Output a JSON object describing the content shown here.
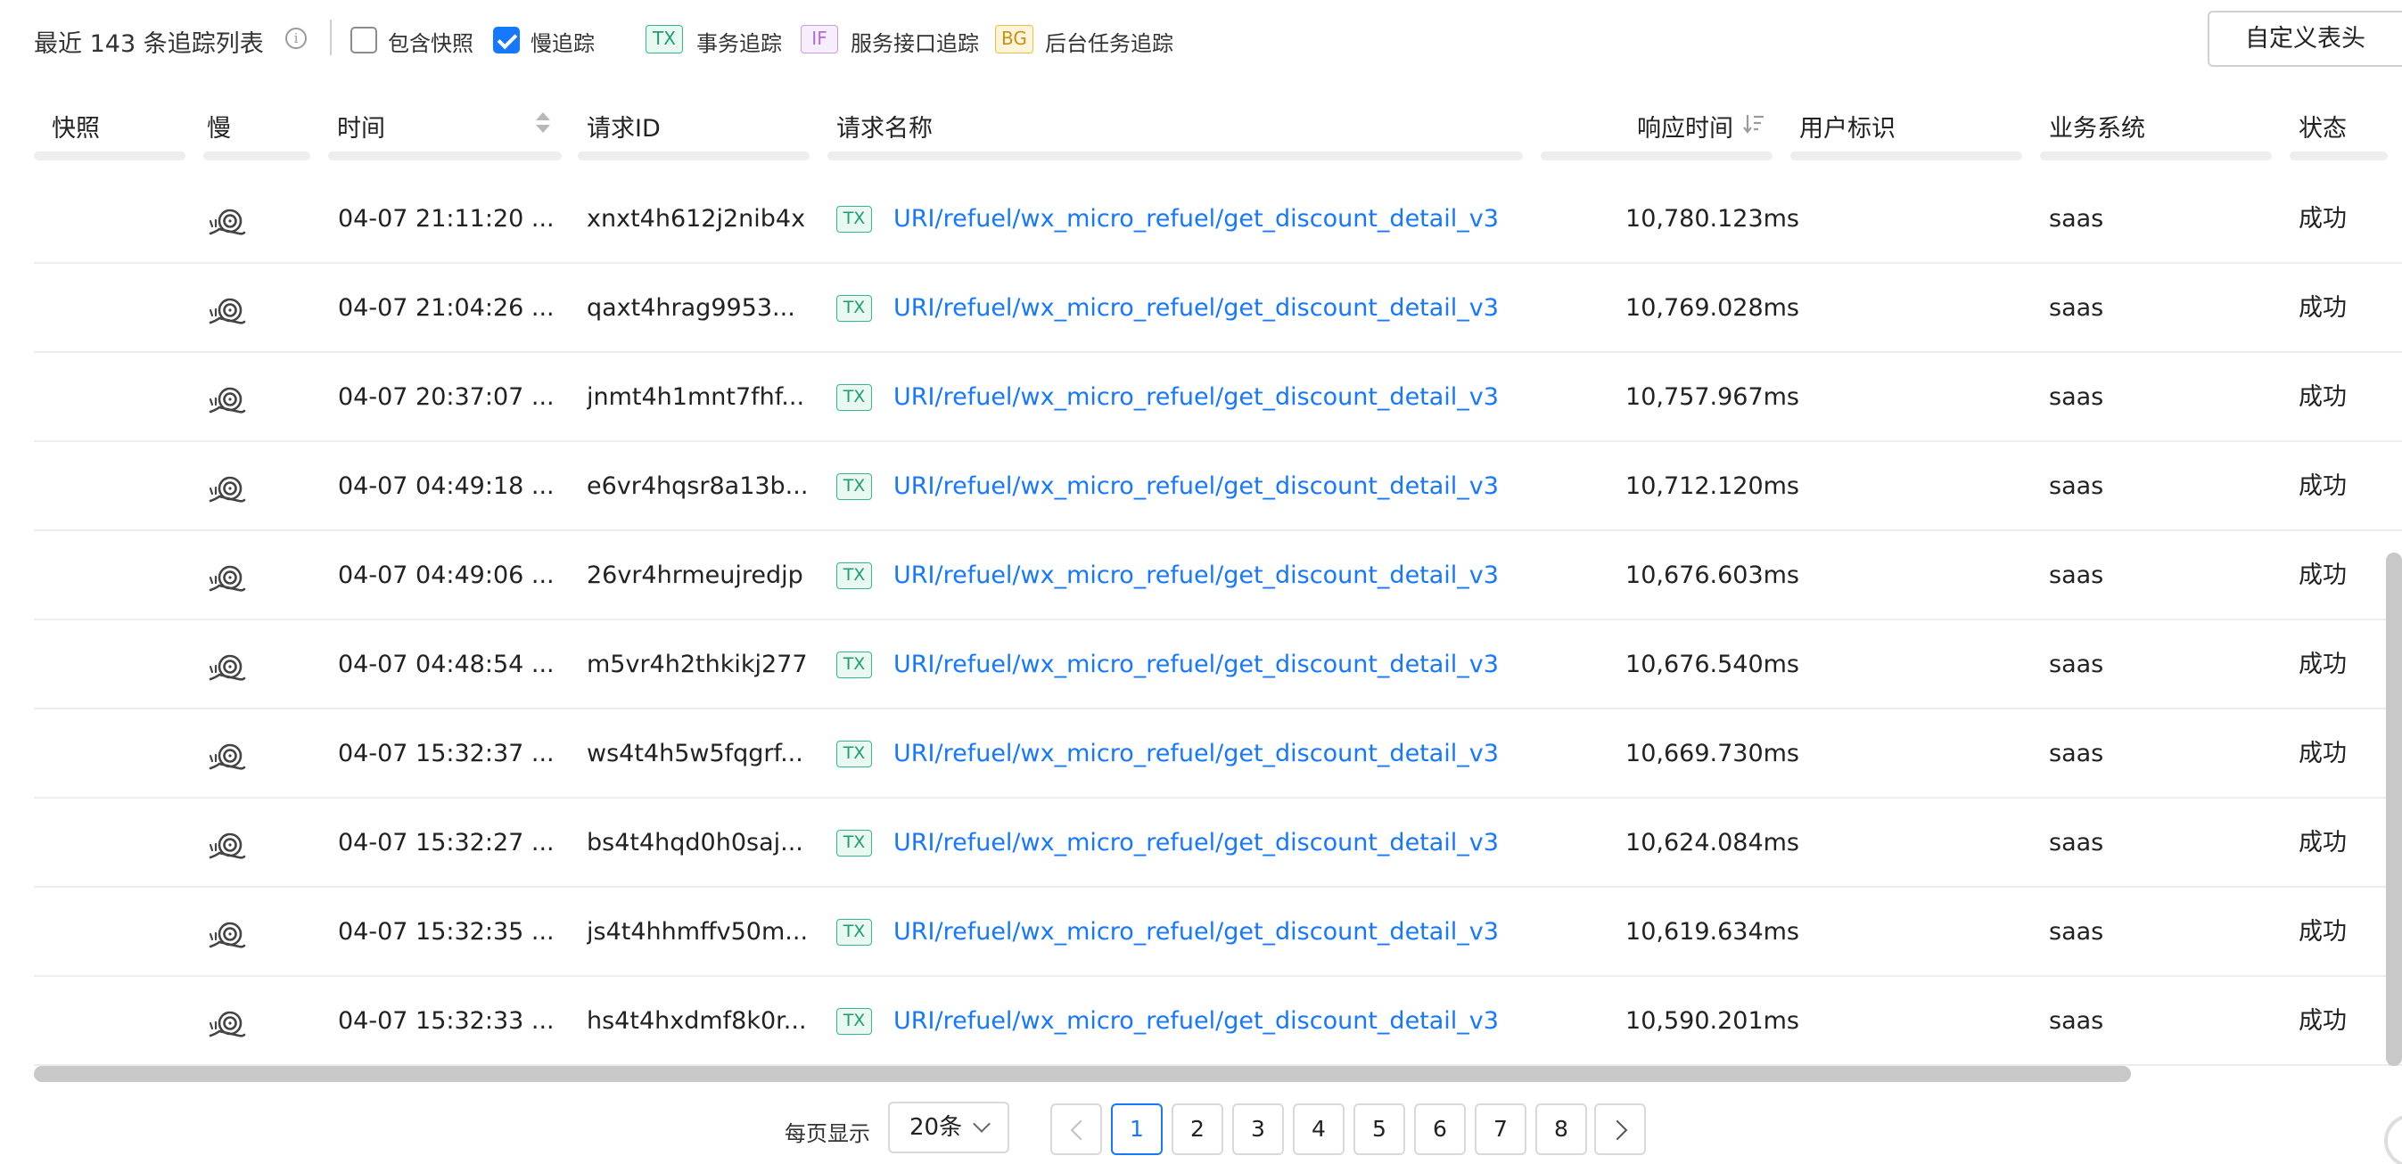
{
  "toolbar": {
    "title": "最近 143 条追踪列表",
    "include_snapshot_label": "包含快照",
    "include_snapshot_checked": false,
    "slow_trace_label": "慢追踪",
    "slow_trace_checked": true,
    "legend": [
      {
        "tag": "TX",
        "label": "事务追踪",
        "color": "#1a9e74"
      },
      {
        "tag": "IF",
        "label": "服务接口追踪",
        "color": "#b46ad2"
      },
      {
        "tag": "BG",
        "label": "后台任务追踪",
        "color": "#c9910f"
      }
    ],
    "custom_header_button": "自定义表头"
  },
  "table": {
    "columns": {
      "snapshot": "快照",
      "slow": "慢",
      "time": "时间",
      "request_id": "请求ID",
      "request_name": "请求名称",
      "response_time": "响应时间",
      "user_id": "用户标识",
      "business_system": "业务系统",
      "status": "状态"
    },
    "rows": [
      {
        "time": "04-07 21:11:20 ...",
        "request_id": "xnxt4h612j2nib4x",
        "tag": "TX",
        "request_name": "URI/refuel/wx_micro_refuel/get_discount_detail_v3",
        "response_time": "10,780.123ms",
        "business_system": "saas",
        "status": "成功"
      },
      {
        "time": "04-07 21:04:26 ...",
        "request_id": "qaxt4hrag9953...",
        "tag": "TX",
        "request_name": "URI/refuel/wx_micro_refuel/get_discount_detail_v3",
        "response_time": "10,769.028ms",
        "business_system": "saas",
        "status": "成功"
      },
      {
        "time": "04-07 20:37:07 ...",
        "request_id": "jnmt4h1mnt7fhf...",
        "tag": "TX",
        "request_name": "URI/refuel/wx_micro_refuel/get_discount_detail_v3",
        "response_time": "10,757.967ms",
        "business_system": "saas",
        "status": "成功"
      },
      {
        "time": "04-07 04:49:18 ...",
        "request_id": "e6vr4hqsr8a13b...",
        "tag": "TX",
        "request_name": "URI/refuel/wx_micro_refuel/get_discount_detail_v3",
        "response_time": "10,712.120ms",
        "business_system": "saas",
        "status": "成功"
      },
      {
        "time": "04-07 04:49:06 ...",
        "request_id": "26vr4hrmeujredjp",
        "tag": "TX",
        "request_name": "URI/refuel/wx_micro_refuel/get_discount_detail_v3",
        "response_time": "10,676.603ms",
        "business_system": "saas",
        "status": "成功"
      },
      {
        "time": "04-07 04:48:54 ...",
        "request_id": "m5vr4h2thkikj277",
        "tag": "TX",
        "request_name": "URI/refuel/wx_micro_refuel/get_discount_detail_v3",
        "response_time": "10,676.540ms",
        "business_system": "saas",
        "status": "成功"
      },
      {
        "time": "04-07 15:32:37 ...",
        "request_id": "ws4t4h5w5fqgrf...",
        "tag": "TX",
        "request_name": "URI/refuel/wx_micro_refuel/get_discount_detail_v3",
        "response_time": "10,669.730ms",
        "business_system": "saas",
        "status": "成功"
      },
      {
        "time": "04-07 15:32:27 ...",
        "request_id": "bs4t4hqd0h0saj...",
        "tag": "TX",
        "request_name": "URI/refuel/wx_micro_refuel/get_discount_detail_v3",
        "response_time": "10,624.084ms",
        "business_system": "saas",
        "status": "成功"
      },
      {
        "time": "04-07 15:32:35 ...",
        "request_id": "js4t4hhmffv50m...",
        "tag": "TX",
        "request_name": "URI/refuel/wx_micro_refuel/get_discount_detail_v3",
        "response_time": "10,619.634ms",
        "business_system": "saas",
        "status": "成功"
      },
      {
        "time": "04-07 15:32:33 ...",
        "request_id": "hs4t4hxdmf8k0r...",
        "tag": "TX",
        "request_name": "URI/refuel/wx_micro_refuel/get_discount_detail_v3",
        "response_time": "10,590.201ms",
        "business_system": "saas",
        "status": "成功"
      }
    ]
  },
  "pagination": {
    "page_size_label": "每页显示",
    "page_size_value": "20条",
    "pages": [
      "1",
      "2",
      "3",
      "4",
      "5",
      "6",
      "7",
      "8"
    ],
    "current_page": "1"
  },
  "icons": {
    "info": "info-icon",
    "slow": "snail-icon",
    "sort_time": "sort-arrows-icon",
    "sort_response": "sort-descending-icon",
    "prev": "chevron-left-icon",
    "next": "chevron-right-icon",
    "dropdown": "chevron-down-icon"
  }
}
